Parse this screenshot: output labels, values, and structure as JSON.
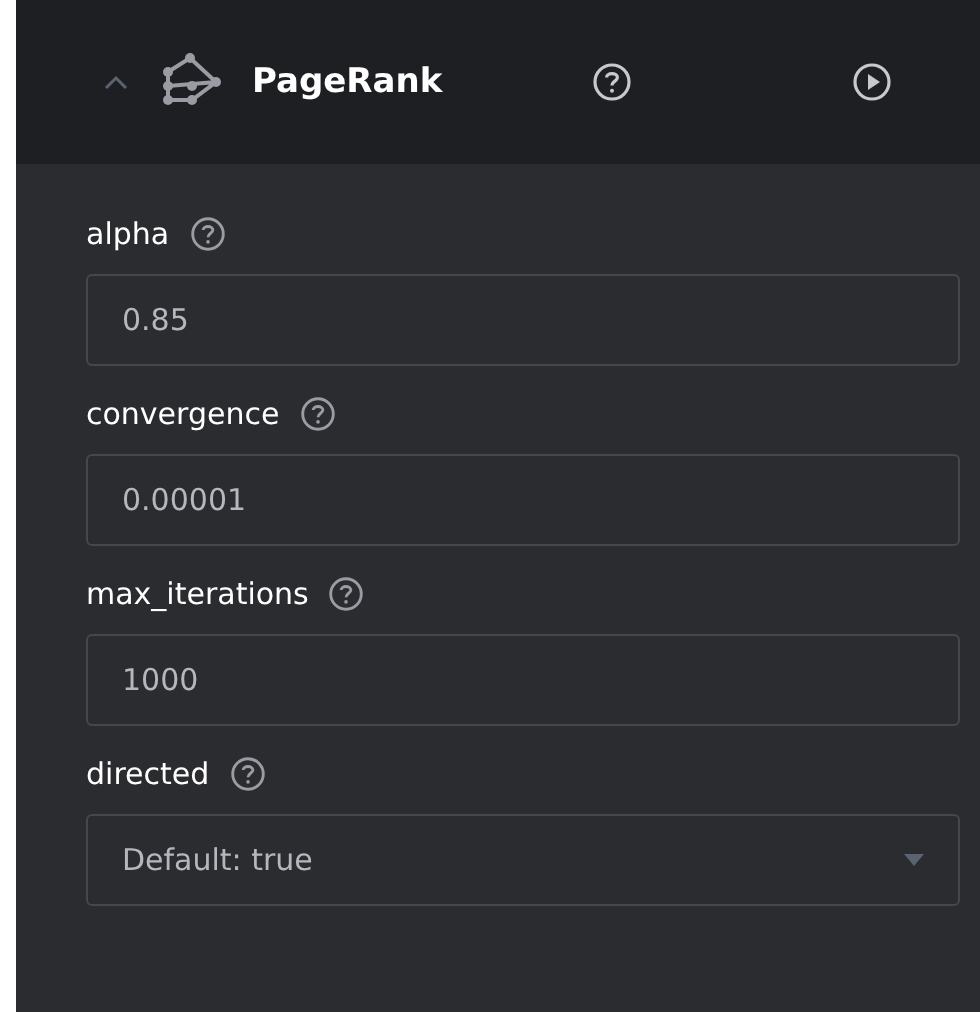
{
  "header": {
    "title": "PageRank",
    "expanded": true
  },
  "params": [
    {
      "kind": "input",
      "label": "alpha",
      "value": "0.85"
    },
    {
      "kind": "input",
      "label": "convergence",
      "value": "0.00001"
    },
    {
      "kind": "input",
      "label": "max_iterations",
      "value": "1000"
    },
    {
      "kind": "select",
      "label": "directed",
      "placeholder": "Default: true"
    }
  ]
}
